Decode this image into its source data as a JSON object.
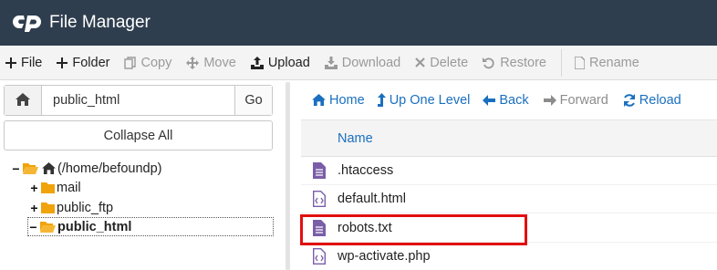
{
  "app": {
    "title": "File Manager",
    "logo": "cpanel-logo-icon"
  },
  "toolbar": {
    "buttons": [
      {
        "label": "File",
        "icon": "plus-icon",
        "enabled": true
      },
      {
        "label": "Folder",
        "icon": "plus-icon",
        "enabled": true
      },
      {
        "label": "Copy",
        "icon": "copy-icon",
        "enabled": false
      },
      {
        "label": "Move",
        "icon": "move-arrows-icon",
        "enabled": false
      },
      {
        "label": "Upload",
        "icon": "upload-icon",
        "enabled": true
      },
      {
        "label": "Download",
        "icon": "download-icon",
        "enabled": false
      },
      {
        "label": "Delete",
        "icon": "x-icon",
        "enabled": false
      },
      {
        "label": "Restore",
        "icon": "undo-icon",
        "enabled": false
      },
      {
        "label": "Rename",
        "icon": "rename-file-icon",
        "enabled": false
      }
    ]
  },
  "path_bar": {
    "value": "public_html",
    "go_label": "Go"
  },
  "collapse_all_label": "Collapse All",
  "tree": {
    "root": "(/home/befoundp)",
    "items": [
      {
        "label": "mail",
        "expanded": false
      },
      {
        "label": "public_ftp",
        "expanded": false
      },
      {
        "label": "public_html",
        "expanded": true,
        "selected": true
      }
    ]
  },
  "nav": {
    "home": "Home",
    "up_one_level": "Up One Level",
    "back": "Back",
    "forward": "Forward",
    "reload": "Reload"
  },
  "file_list": {
    "column_name": "Name",
    "files": [
      {
        "name": ".htaccess",
        "icon": "text-file-icon"
      },
      {
        "name": "default.html",
        "icon": "code-file-icon"
      },
      {
        "name": "robots.txt",
        "icon": "text-file-icon",
        "highlighted": true
      },
      {
        "name": "wp-activate.php",
        "icon": "code-file-icon"
      }
    ]
  },
  "colors": {
    "header_bg": "#2f3e4e",
    "link_blue": "#1a6fbf",
    "folder": "#f0a30a",
    "file_icon": "#7a5ea8",
    "highlight": "#e20f0f"
  }
}
